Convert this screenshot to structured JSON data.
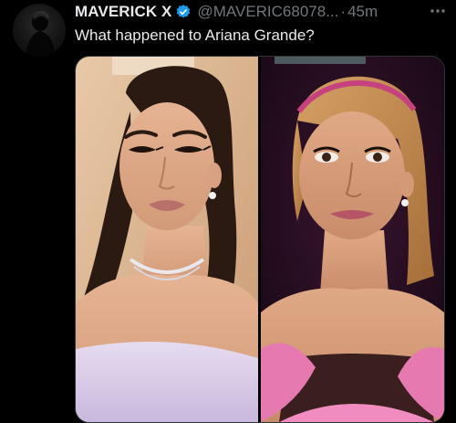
{
  "tweet": {
    "display_name": "MAVERICK X",
    "handle": "@MAVERIC68078...",
    "separator": "·",
    "time": "45m",
    "text": "What happened to Ariana Grande?",
    "avatar_icon": "avatar-silhouette-icon",
    "verified_icon": "verified-badge-icon",
    "more_icon": "more-options-icon"
  },
  "media": {
    "left_photo": "photo-left",
    "right_photo": "photo-right"
  },
  "colors": {
    "background": "#000000",
    "text_primary": "#e7e9ea",
    "text_secondary": "#71767b",
    "verified_blue": "#1d9bf0",
    "border": "#2f3336"
  }
}
